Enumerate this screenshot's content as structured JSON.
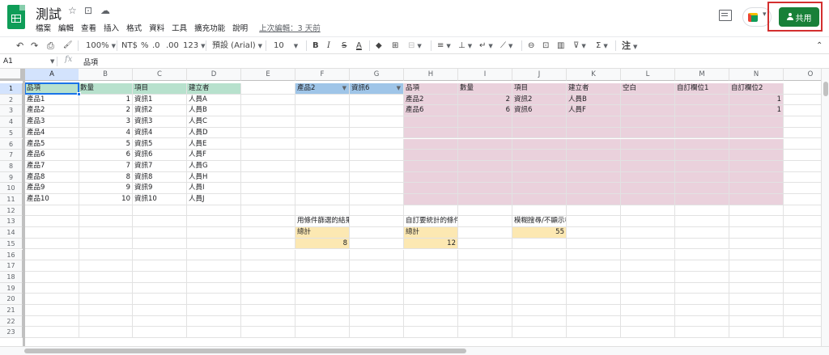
{
  "header": {
    "title": "測試",
    "star_glyph": "☆",
    "move_glyph": "⊡",
    "cloud_glyph": "☁",
    "menu": [
      "檔案",
      "編輯",
      "查看",
      "插入",
      "格式",
      "資料",
      "工具",
      "擴充功能",
      "說明"
    ],
    "last_edit": "上次編輯：3 天前",
    "share_label": "共用",
    "colors": {
      "share_button": "#188038",
      "logo": "#0f9d58",
      "highlight_box": "#d32f2f"
    }
  },
  "toolbar": {
    "undo": "↶",
    "redo": "↷",
    "print": "⎙",
    "paint_format": "🖌",
    "zoom": "100%",
    "currency": "NT$",
    "percent": "%",
    "decrease_decimal": ".0",
    "increase_decimal": ".00",
    "more_formats": "123",
    "font": "預設 (Arial)",
    "font_size": "10",
    "bold": "B",
    "italic": "I",
    "strike": "S",
    "text_color": "A",
    "fill_color": "◆",
    "borders": "⊞",
    "merge": "⊟",
    "h_align": "≡",
    "v_align": "⊥",
    "wrap": "↵",
    "rotate": "⟋",
    "link": "⊖",
    "comment": "⊡",
    "chart": "▥",
    "filter": "⊽",
    "functions": "Σ",
    "input_tools": "注",
    "collapse": "⌃"
  },
  "formula_bar": {
    "name_box": "A1",
    "fx_label": "fx",
    "formula": "品項"
  },
  "columns": [
    "A",
    "B",
    "C",
    "D",
    "E",
    "F",
    "G",
    "H",
    "I",
    "J",
    "K",
    "L",
    "M",
    "N",
    "O"
  ],
  "rows": [
    "1",
    "2",
    "3",
    "4",
    "5",
    "6",
    "7",
    "8",
    "9",
    "10",
    "11",
    "12",
    "13",
    "14",
    "15",
    "16",
    "17",
    "18",
    "19",
    "20",
    "21",
    "22",
    "23"
  ],
  "cells": [
    {
      "r": 1,
      "c": 0,
      "v": "品項",
      "s": "green"
    },
    {
      "r": 1,
      "c": 1,
      "v": "數量",
      "s": "green"
    },
    {
      "r": 1,
      "c": 2,
      "v": "項目",
      "s": "green"
    },
    {
      "r": 1,
      "c": 3,
      "v": "建立者",
      "s": "green"
    },
    {
      "r": 1,
      "c": 5,
      "v": "產品2",
      "s": "blue",
      "dropdown": true
    },
    {
      "r": 1,
      "c": 6,
      "v": "資訊6",
      "s": "blue",
      "dropdown": true
    },
    {
      "r": 1,
      "c": 7,
      "v": "品項",
      "s": "pink"
    },
    {
      "r": 1,
      "c": 8,
      "v": "數量",
      "s": "pink"
    },
    {
      "r": 1,
      "c": 9,
      "v": "項目",
      "s": "pink"
    },
    {
      "r": 1,
      "c": 10,
      "v": "建立者",
      "s": "pink"
    },
    {
      "r": 1,
      "c": 11,
      "v": "空白",
      "s": "pink"
    },
    {
      "r": 1,
      "c": 12,
      "v": "自訂欄位1",
      "s": "pink"
    },
    {
      "r": 1,
      "c": 13,
      "v": "自訂欄位2",
      "s": "pink"
    },
    {
      "r": 2,
      "c": 0,
      "v": "產品1"
    },
    {
      "r": 2,
      "c": 1,
      "v": "1",
      "num": true
    },
    {
      "r": 2,
      "c": 2,
      "v": "資訊1"
    },
    {
      "r": 2,
      "c": 3,
      "v": "人員A"
    },
    {
      "r": 3,
      "c": 0,
      "v": "產品2"
    },
    {
      "r": 3,
      "c": 1,
      "v": "2",
      "num": true
    },
    {
      "r": 3,
      "c": 2,
      "v": "資訊2"
    },
    {
      "r": 3,
      "c": 3,
      "v": "人員B"
    },
    {
      "r": 4,
      "c": 0,
      "v": "產品3"
    },
    {
      "r": 4,
      "c": 1,
      "v": "3",
      "num": true
    },
    {
      "r": 4,
      "c": 2,
      "v": "資訊3"
    },
    {
      "r": 4,
      "c": 3,
      "v": "人員C"
    },
    {
      "r": 5,
      "c": 0,
      "v": "產品4"
    },
    {
      "r": 5,
      "c": 1,
      "v": "4",
      "num": true
    },
    {
      "r": 5,
      "c": 2,
      "v": "資訊4"
    },
    {
      "r": 5,
      "c": 3,
      "v": "人員D"
    },
    {
      "r": 6,
      "c": 0,
      "v": "產品5"
    },
    {
      "r": 6,
      "c": 1,
      "v": "5",
      "num": true
    },
    {
      "r": 6,
      "c": 2,
      "v": "資訊5"
    },
    {
      "r": 6,
      "c": 3,
      "v": "人員E"
    },
    {
      "r": 7,
      "c": 0,
      "v": "產品6"
    },
    {
      "r": 7,
      "c": 1,
      "v": "6",
      "num": true
    },
    {
      "r": 7,
      "c": 2,
      "v": "資訊6"
    },
    {
      "r": 7,
      "c": 3,
      "v": "人員F"
    },
    {
      "r": 8,
      "c": 0,
      "v": "產品7"
    },
    {
      "r": 8,
      "c": 1,
      "v": "7",
      "num": true
    },
    {
      "r": 8,
      "c": 2,
      "v": "資訊7"
    },
    {
      "r": 8,
      "c": 3,
      "v": "人員G"
    },
    {
      "r": 9,
      "c": 0,
      "v": "產品8"
    },
    {
      "r": 9,
      "c": 1,
      "v": "8",
      "num": true
    },
    {
      "r": 9,
      "c": 2,
      "v": "資訊8"
    },
    {
      "r": 9,
      "c": 3,
      "v": "人員H"
    },
    {
      "r": 10,
      "c": 0,
      "v": "產品9"
    },
    {
      "r": 10,
      "c": 1,
      "v": "9",
      "num": true
    },
    {
      "r": 10,
      "c": 2,
      "v": "資訊9"
    },
    {
      "r": 10,
      "c": 3,
      "v": "人員I"
    },
    {
      "r": 11,
      "c": 0,
      "v": "產品10"
    },
    {
      "r": 11,
      "c": 1,
      "v": "10",
      "num": true
    },
    {
      "r": 11,
      "c": 2,
      "v": "資訊10"
    },
    {
      "r": 11,
      "c": 3,
      "v": "人員J"
    },
    {
      "r": 2,
      "c": 7,
      "v": "產品2",
      "s": "pink"
    },
    {
      "r": 2,
      "c": 8,
      "v": "2",
      "num": true,
      "s": "pink"
    },
    {
      "r": 2,
      "c": 9,
      "v": "資訊2",
      "s": "pink"
    },
    {
      "r": 2,
      "c": 10,
      "v": "人員B",
      "s": "pink"
    },
    {
      "r": 2,
      "c": 11,
      "v": "",
      "s": "pink"
    },
    {
      "r": 2,
      "c": 12,
      "v": "",
      "s": "pink"
    },
    {
      "r": 2,
      "c": 13,
      "v": "1",
      "num": true,
      "s": "pink"
    },
    {
      "r": 3,
      "c": 7,
      "v": "產品6",
      "s": "pink"
    },
    {
      "r": 3,
      "c": 8,
      "v": "6",
      "num": true,
      "s": "pink"
    },
    {
      "r": 3,
      "c": 9,
      "v": "資訊6",
      "s": "pink"
    },
    {
      "r": 3,
      "c": 10,
      "v": "人員F",
      "s": "pink"
    },
    {
      "r": 3,
      "c": 11,
      "v": "",
      "s": "pink"
    },
    {
      "r": 3,
      "c": 12,
      "v": "",
      "s": "pink"
    },
    {
      "r": 3,
      "c": 13,
      "v": "1",
      "num": true,
      "s": "pink"
    },
    {
      "r": 13,
      "c": 5,
      "v": "用條件篩選的結果"
    },
    {
      "r": 13,
      "c": 7,
      "v": "自訂要統計的條件"
    },
    {
      "r": 13,
      "c": 9,
      "v": "模糊搜尋/不顯示標題"
    },
    {
      "r": 14,
      "c": 5,
      "v": "總計",
      "s": "yellow"
    },
    {
      "r": 14,
      "c": 7,
      "v": "總計",
      "s": "yellow"
    },
    {
      "r": 14,
      "c": 9,
      "v": "55",
      "num": true,
      "s": "yellow"
    },
    {
      "r": 15,
      "c": 5,
      "v": "8",
      "num": true,
      "s": "yellow"
    },
    {
      "r": 15,
      "c": 7,
      "v": "12",
      "num": true,
      "s": "yellow"
    }
  ],
  "pink_block": {
    "rows": [
      4,
      5,
      6,
      7,
      8,
      9,
      10,
      11
    ],
    "cols": [
      7,
      8,
      9,
      10,
      11,
      12,
      13
    ]
  },
  "selection": {
    "row": 1,
    "col": 0
  },
  "fill_colors": {
    "green": "#b7e1cd",
    "blue": "#9fc5e8",
    "pink": "#ead1dc",
    "yellow": "#fce8b2"
  }
}
